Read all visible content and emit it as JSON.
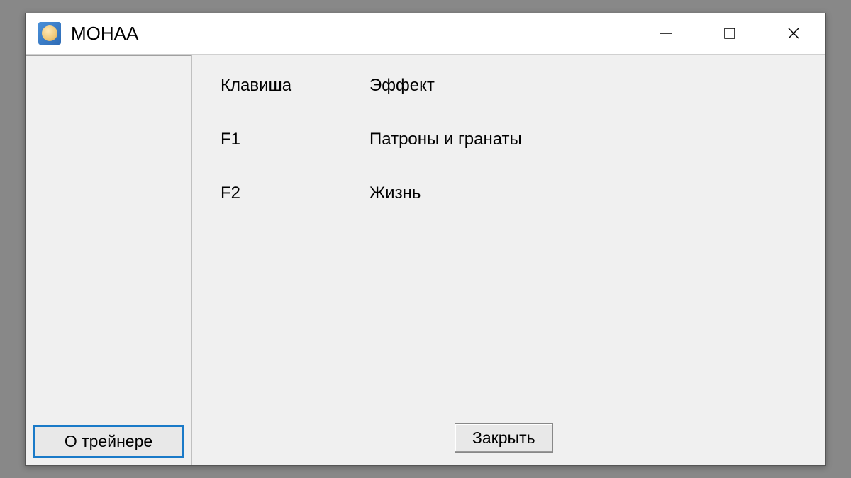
{
  "window": {
    "title": "MOHAA"
  },
  "headers": {
    "key": "Клавиша",
    "effect": "Эффект"
  },
  "rows": [
    {
      "key": "F1",
      "effect": "Патроны и гранаты"
    },
    {
      "key": "F2",
      "effect": "Жизнь"
    }
  ],
  "buttons": {
    "about": "О трейнере",
    "close": "Закрыть"
  }
}
